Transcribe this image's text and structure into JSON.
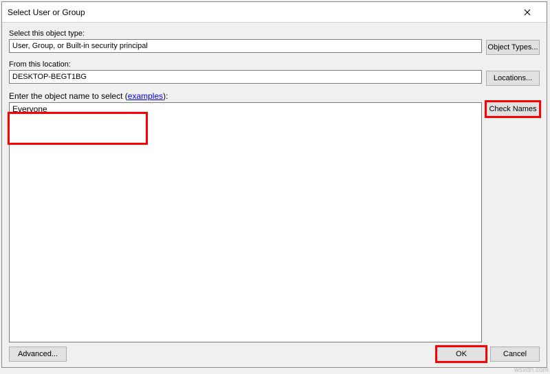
{
  "window": {
    "title": "Select User or Group"
  },
  "objectType": {
    "label": "Select this object type:",
    "value": "User, Group, or Built-in security principal",
    "button": "Object Types..."
  },
  "location": {
    "label": "From this location:",
    "value": "DESKTOP-BEGT1BG",
    "button": "Locations..."
  },
  "objectName": {
    "label_prefix": "Enter the object name to select (",
    "examples_link": "examples",
    "label_suffix": "):",
    "value": "Everyone",
    "button": "Check Names"
  },
  "footer": {
    "advanced": "Advanced...",
    "ok": "OK",
    "cancel": "Cancel"
  },
  "watermark": "wsxdn.com"
}
